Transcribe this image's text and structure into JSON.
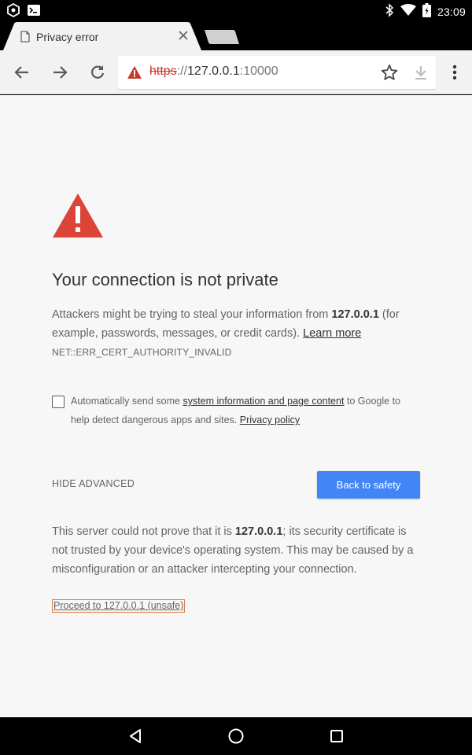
{
  "status_bar": {
    "time": "23:09",
    "left_icons": [
      "app-notification-icon",
      "terminal-icon"
    ],
    "right_icons": [
      "bluetooth-icon",
      "wifi-icon",
      "battery-icon"
    ]
  },
  "tab": {
    "title": "Privacy error",
    "close_icon": "close-icon"
  },
  "omnibox": {
    "url_scheme": "https",
    "url_separator": "://",
    "url_host": "127.0.0.1",
    "url_port": ":10000"
  },
  "content": {
    "heading": "Your connection is not private",
    "intro_prefix": "Attackers might be trying to steal your information from ",
    "intro_host": "127.0.0.1",
    "intro_suffix": " (for example, passwords, messages, or credit cards). ",
    "learn_more": "Learn more",
    "error_code": "NET::ERR_CERT_AUTHORITY_INVALID",
    "checkbox_prefix": "Automatically send some ",
    "checkbox_link": "system information and page content",
    "checkbox_suffix": " to Google to help detect dangerous apps and sites. ",
    "privacy_policy": "Privacy policy",
    "hide_advanced": "HIDE ADVANCED",
    "back_to_safety": "Back to safety",
    "details_prefix": "This server could not prove that it is ",
    "details_host": "127.0.0.1",
    "details_suffix": "; its security certificate is not trusted by your device's operating system. This may be caused by a misconfiguration or an attacker intercepting your connection.",
    "proceed_link": "Proceed to 127.0.0.1 (unsafe)"
  },
  "colors": {
    "warning_red": "#db4437",
    "primary_blue": "#4285f4",
    "page_background": "#f7f7f7",
    "url_scheme_red": "#c53929"
  }
}
